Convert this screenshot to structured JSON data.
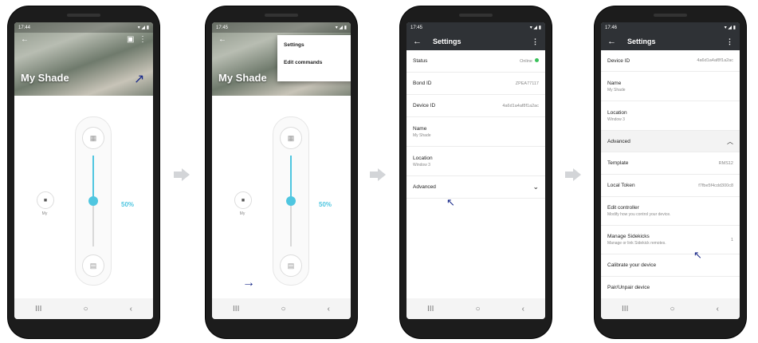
{
  "phone1": {
    "status_time": "17:44",
    "title": "My Shade",
    "my_label": "My",
    "percent": "50%",
    "slider_level": 0.5
  },
  "phone2": {
    "status_time": "17:45",
    "title": "My Shade",
    "my_label": "My",
    "percent": "50%",
    "menu": [
      "Settings",
      "Edit commands"
    ]
  },
  "phone3": {
    "status_time": "17:45",
    "appbar_title": "Settings",
    "rows": {
      "status_label": "Status",
      "status_value": "Online",
      "bond_label": "Bond ID",
      "bond_value": "ZPEA77117",
      "device_label": "Device ID",
      "device_value": "4a6d1a4af8f1a2ac",
      "name_label": "Name",
      "name_value": "My Shade",
      "location_label": "Location",
      "location_value": "Window 3",
      "advanced_label": "Advanced"
    }
  },
  "phone4": {
    "status_time": "17:46",
    "appbar_title": "Settings",
    "rows": {
      "device_label": "Device ID",
      "device_value": "4a6d1a4af8f1a2ac",
      "name_label": "Name",
      "name_value": "My Shade",
      "location_label": "Location",
      "location_value": "Window 3",
      "advanced_label": "Advanced",
      "template_label": "Template",
      "template_value": "RMS12",
      "token_label": "Local Token",
      "token_value": "f7fbe5f4cdd300c8",
      "edit_label": "Edit controller",
      "edit_sub": "Modify how you control your device.",
      "sidekicks_label": "Manage Sidekicks",
      "sidekicks_sub": "Manage or link Sidekick remotes.",
      "sidekicks_count": "1",
      "calibrate_label": "Calibrate your device",
      "pair_label": "Pair/Unpair device"
    }
  },
  "colors": {
    "accent": "#4fc6e0",
    "online": "#39c15a",
    "appbar": "#2f3236",
    "annotation_arrow": "#1a2a8a"
  },
  "icons": [
    "back-arrow-icon",
    "overflow-menu-icon",
    "calendar-icon",
    "shade-open-icon",
    "shade-close-icon",
    "chevron-down-icon",
    "chevron-up-icon",
    "next-step-arrow-icon"
  ]
}
